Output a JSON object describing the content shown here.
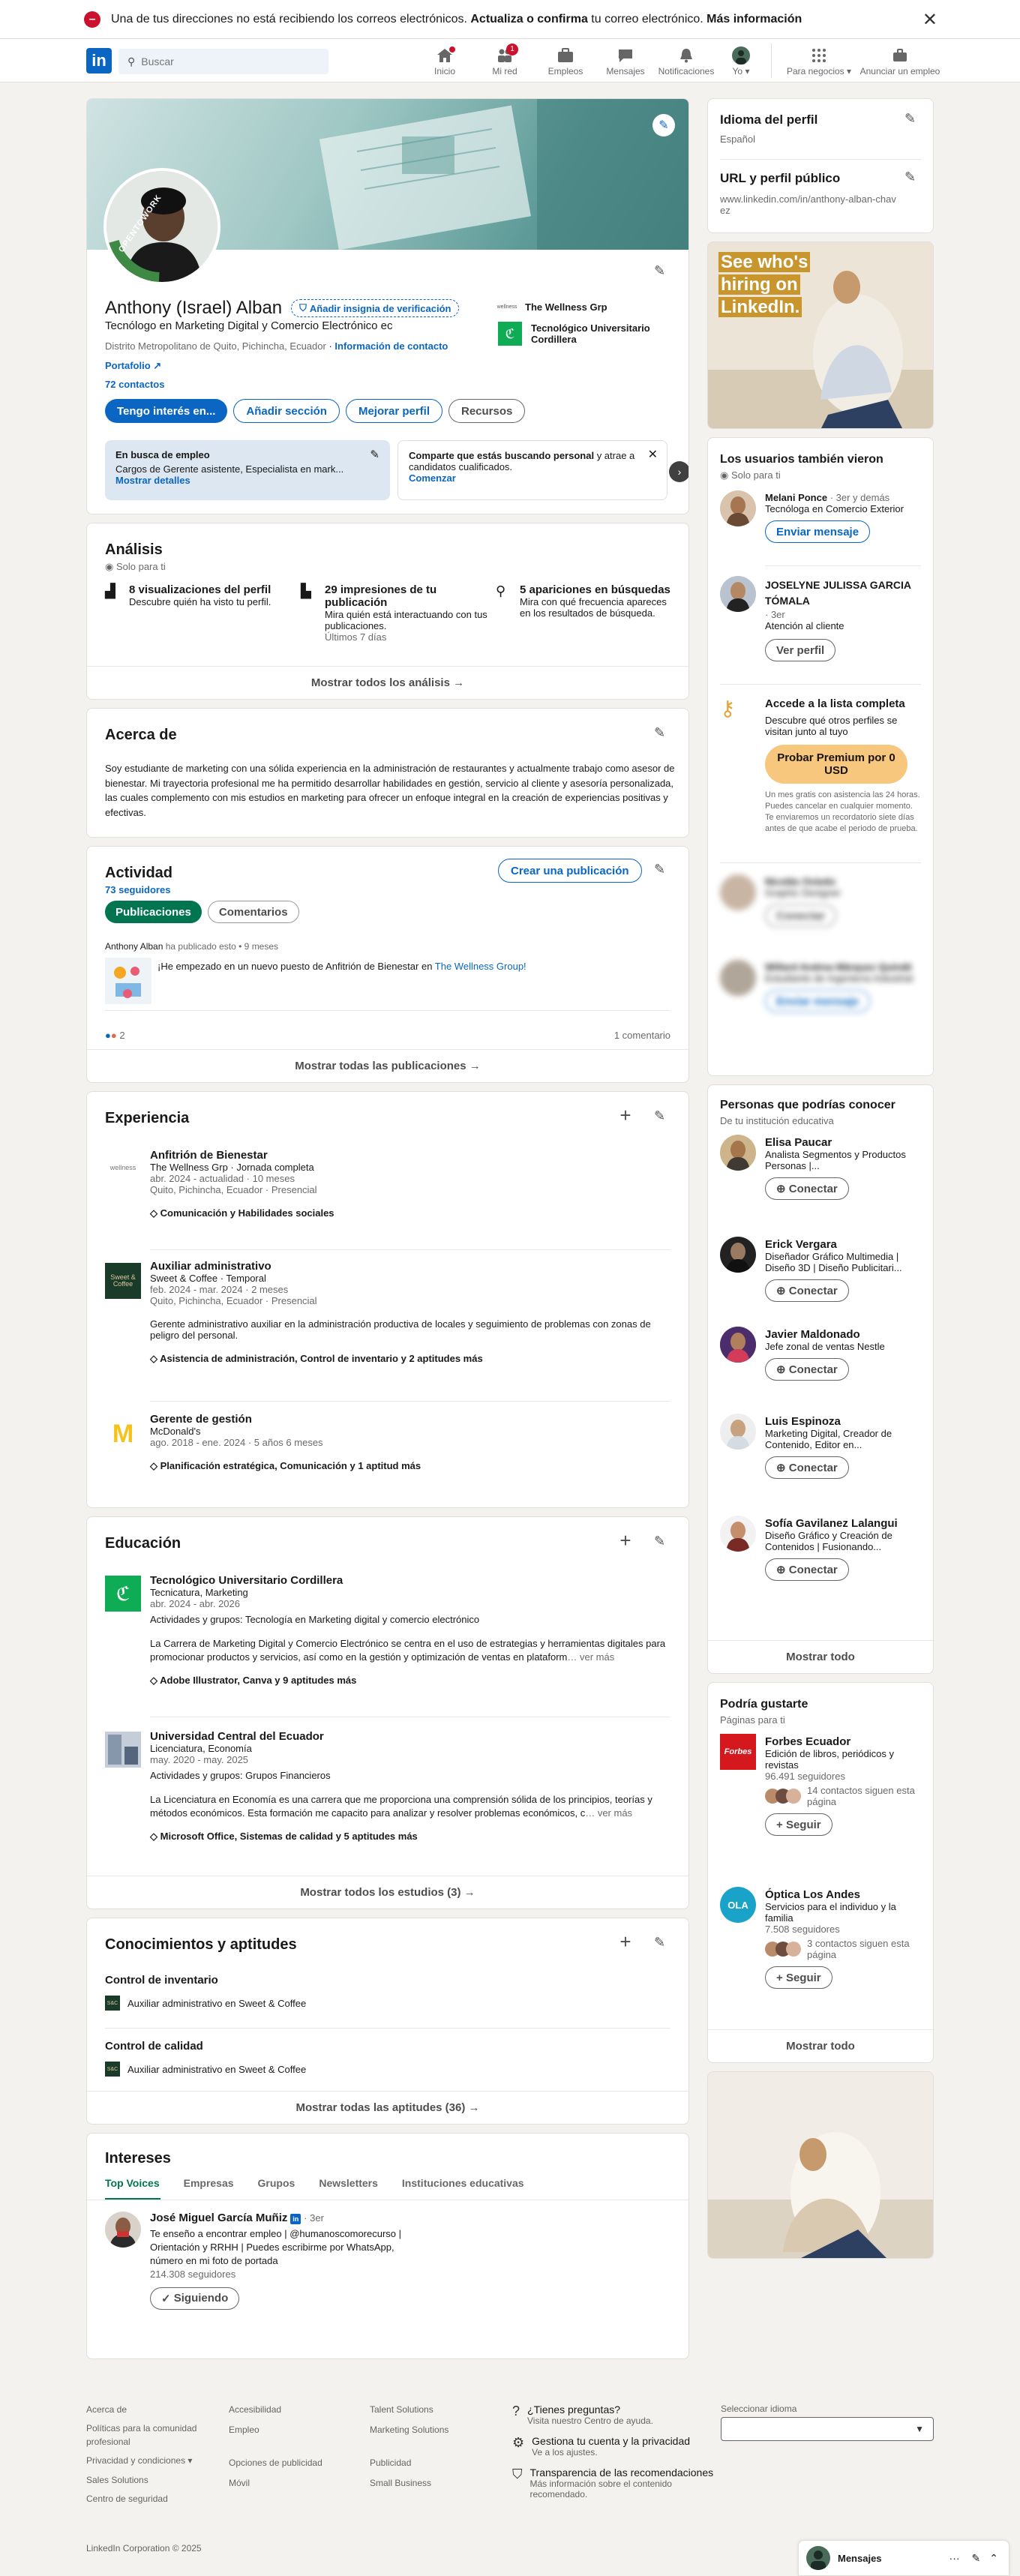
{
  "alert": {
    "text_before": "Una de tus direcciones no está recibiendo los correos electrónicos. ",
    "link1": "Actualiza o confirma",
    "text_mid": " tu correo electrónico. ",
    "link2": "Más información"
  },
  "nav": {
    "search_placeholder": "Buscar",
    "items": [
      {
        "label": "Inicio",
        "badge": ""
      },
      {
        "label": "Mi red",
        "badge": "1"
      },
      {
        "label": "Empleos",
        "badge": ""
      },
      {
        "label": "Mensajes",
        "badge": ""
      },
      {
        "label": "Notificaciones",
        "badge": ""
      },
      {
        "label": "Yo",
        "badge": ""
      }
    ],
    "business": "Para negocios",
    "advertise": "Anunciar un empleo"
  },
  "profile": {
    "cover_badge": "OPENTOWORK",
    "name": "Anthony (Israel) Alban",
    "verify": "Añadir insignia de verificación",
    "headline": "Tecnólogo en Marketing Digital y Comercio Electrónico ec",
    "location": "Distrito Metropolitano de Quito, Pichincha, Ecuador",
    "contact_info": "Información de contacto",
    "portfolio": "Portafolio",
    "connections": "72 contactos",
    "company1": "The Wellness Grp",
    "company2": "Tecnológico Universitario Cordillera",
    "buttons": {
      "interested": "Tengo interés en...",
      "add_section": "Añadir sección",
      "improve": "Mejorar perfil",
      "resources": "Recursos"
    },
    "otw": {
      "title": "En busca de empleo",
      "text": "Cargos de Gerente asistente, Especialista en mark...",
      "show": "Mostrar detalles"
    },
    "share": {
      "text_bold": "Comparte que estás buscando personal",
      "text_rest": " y atrae a candidatos cualificados.",
      "start": "Comenzar"
    }
  },
  "analytics": {
    "title": "Análisis",
    "private": "Solo para ti",
    "items": [
      {
        "title": "8 visualizaciones del perfil",
        "desc": "Descubre quién ha visto tu perfil.",
        "sub": ""
      },
      {
        "title": "29 impresiones de tu publicación",
        "desc": "Mira quién está interactuando con tus publicaciones.",
        "sub": "Últimos 7 días"
      },
      {
        "title": "5 apariciones en búsquedas",
        "desc": "Mira con qué frecuencia apareces en los resultados de búsqueda.",
        "sub": ""
      }
    ],
    "show_all": "Mostrar todos los análisis →"
  },
  "about": {
    "title": "Acerca de",
    "text": "Soy estudiante de marketing con una sólida experiencia en la administración de restaurantes y actualmente trabajo como asesor de bienestar. Mi trayectoria profesional me ha permitido desarrollar habilidades en gestión, servicio al cliente y asesoría personalizada, las cuales complemento con mis estudios en marketing para ofrecer un enfoque integral en la creación de experiencias positivas y efectivas."
  },
  "activity": {
    "title": "Actividad",
    "followers": "73 seguidores",
    "create": "Crear una publicación",
    "tab_posts": "Publicaciones",
    "tab_comments": "Comentarios",
    "post_meta_name": "Anthony Alban",
    "post_meta_rest": " ha publicado esto • 9 meses",
    "post_text": "¡He empezado en un nuevo puesto de Anfitrión de Bienestar en ",
    "post_link": "The Wellness Group!",
    "reactions": "2",
    "comments": "1 comentario",
    "show_all": "Mostrar todas las publicaciones →"
  },
  "experience": {
    "title": "Experiencia",
    "items": [
      {
        "role": "Anfitrión de Bienestar",
        "company": "The Wellness Grp · Jornada completa",
        "dates": "abr. 2024 - actualidad · 10 meses",
        "location": "Quito, Pichincha, Ecuador · Presencial",
        "desc": "",
        "skills": "Comunicación y Habilidades sociales"
      },
      {
        "role": "Auxiliar administrativo",
        "company": "Sweet & Coffee · Temporal",
        "dates": "feb. 2024 - mar. 2024 · 2 meses",
        "location": "Quito, Pichincha, Ecuador · Presencial",
        "desc": "Gerente administrativo auxiliar en la administración productiva de locales y seguimiento de problemas con zonas de peligro del personal.",
        "skills": "Asistencia de administración, Control de inventario y 2 aptitudes más"
      },
      {
        "role": "Gerente de gestión",
        "company": "McDonald's",
        "dates": "ago. 2018 - ene. 2024 · 5 años 6 meses",
        "location": "",
        "desc": "",
        "skills": "Planificación estratégica, Comunicación y 1 aptitud más"
      }
    ]
  },
  "education": {
    "title": "Educación",
    "items": [
      {
        "school": "Tecnológico Universitario Cordillera",
        "degree": "Tecnicatura, Marketing",
        "dates": "abr. 2024 - abr. 2026",
        "groups": "Actividades y grupos: Tecnología en Marketing digital y comercio electrónico",
        "desc": "La Carrera de Marketing Digital y Comercio Electrónico se centra en el uso de estrategias y herramientas digitales para promocionar productos y servicios, así como en la gestión y optimización de ventas en plataform",
        "more": "… ver más",
        "skills": "Adobe Illustrator, Canva y 9 aptitudes más"
      },
      {
        "school": "Universidad Central del Ecuador",
        "degree": "Licenciatura, Economía",
        "dates": "may. 2020 - may. 2025",
        "groups": "Actividades y grupos: Grupos Financieros",
        "desc": "La Licenciatura en Economía es una carrera que me proporciona una comprensión sólida de los principios, teorías y métodos económicos. Esta formación me capacito para analizar y resolver problemas económicos, c",
        "more": "… ver más",
        "skills": "Microsoft Office, Sistemas de calidad y 5 aptitudes más"
      }
    ],
    "show_all": "Mostrar todos los estudios (3) →"
  },
  "skills": {
    "title": "Conocimientos y aptitudes",
    "items": [
      {
        "name": "Control de inventario",
        "where": "Auxiliar administrativo en Sweet & Coffee"
      },
      {
        "name": "Control de calidad",
        "where": "Auxiliar administrativo en Sweet & Coffee"
      }
    ],
    "show_all": "Mostrar todas las aptitudes (36) →"
  },
  "interests": {
    "title": "Intereses",
    "tabs": [
      "Top Voices",
      "Empresas",
      "Grupos",
      "Newsletters",
      "Instituciones educativas"
    ],
    "person": {
      "name": "José Miguel García Muñiz",
      "degree": "· 3er",
      "desc": "Te enseño a encontrar empleo | @humanoscomorecurso | Orientación y RRHH | Puedes escribirme por WhatsApp, número en mi foto de portada",
      "followers": "214.308 seguidores",
      "button": "Siguiendo"
    }
  },
  "sidebar": {
    "lang_title": "Idioma del perfil",
    "lang_value": "Español",
    "url_title": "URL y perfil público",
    "url_value": "www.linkedin.com/in/anthony-alban-chavez",
    "ad_text": "See who's hiring on LinkedIn.",
    "viewers_title": "Los usuarios también vieron",
    "viewers_private": "Solo para ti",
    "viewers": [
      {
        "name": "Melani Ponce",
        "meta": "· 3er y demás",
        "title": "Tecnóloga en Comercio Exterior",
        "button": "Enviar mensaje"
      },
      {
        "name": "JOSELYNE JULISSA GARCIA TÓMALA",
        "meta": "· 3er",
        "title": "Atención al cliente",
        "button": "Ver perfil"
      }
    ],
    "premium_title": "Accede a la lista completa",
    "premium_text": "Descubre qué otros perfiles se visitan junto al tuyo",
    "premium_button": "Probar Premium por 0 USD",
    "premium_fine": "Un mes gratis con asistencia las 24 horas. Puedes cancelar en cualquier momento. Te enviaremos un recordatorio siete días antes de que acabe el periodo de prueba.",
    "blurred": [
      {
        "name": "Nicolás Oviedo",
        "title": "Graphic Designer",
        "button": "Conectar"
      },
      {
        "name": "Willard Andrea Márquez Quindé",
        "title": "Estudiante de Ingeniería Industrial",
        "button": "Enviar mensaje"
      }
    ],
    "pymk_title": "Personas que podrías conocer",
    "pymk_sub": "De tu institución educativa",
    "pymk": [
      {
        "name": "Elisa Paucar",
        "title": "Analista Segmentos y Productos Personas |...",
        "button": "Conectar"
      },
      {
        "name": "Erick Vergara",
        "title": "Diseñador Gráfico Multimedia | Diseño 3D | Diseño Publicitari...",
        "button": "Conectar"
      },
      {
        "name": "Javier Maldonado",
        "title": "Jefe zonal de ventas Nestle",
        "button": "Conectar"
      },
      {
        "name": "Luis Espinoza",
        "title": "Marketing Digital, Creador de Contenido, Editor en...",
        "button": "Conectar"
      },
      {
        "name": "Sofía Gavilanez Lalangui",
        "title": "Diseño Gráfico y Creación de Contenidos | Fusionando...",
        "button": "Conectar"
      }
    ],
    "pymk_show": "Mostrar todo",
    "pages_title": "Podría gustarte",
    "pages_sub": "Páginas para ti",
    "pages": [
      {
        "name": "Forbes Ecuador",
        "desc": "Edición de libros, periódicos y revistas",
        "followers": "96.491 seguidores",
        "contacts": "14 contactos siguen esta página",
        "button": "Seguir",
        "logo": "Forbes"
      },
      {
        "name": "Óptica Los Andes",
        "desc": "Servicios para el individuo y la familia",
        "followers": "7.508 seguidores",
        "contacts": "3 contactos siguen esta página",
        "button": "Seguir",
        "logo": "OLA"
      }
    ],
    "pages_show": "Mostrar todo"
  },
  "footer": {
    "col1": [
      "Acerca de",
      "Políticas para la comunidad profesional",
      "Privacidad y condiciones ▾",
      "Sales Solutions",
      "Centro de seguridad"
    ],
    "col2": [
      "Accesibilidad",
      "Empleo",
      "Opciones de publicidad",
      "Móvil"
    ],
    "col3": [
      "Talent Solutions",
      "Marketing Solutions",
      "Publicidad",
      "Small Business"
    ],
    "help": [
      {
        "title": "¿Tienes preguntas?",
        "sub": "Visita nuestro Centro de ayuda."
      },
      {
        "title": "Gestiona tu cuenta y la privacidad",
        "sub": "Ve a los ajustes."
      },
      {
        "title": "Transparencia de las recomendaciones",
        "sub": "Más información sobre el contenido recomendado."
      }
    ],
    "lang_label": "Seleccionar idioma",
    "copyright": "LinkedIn Corporation © 2025"
  },
  "messaging": {
    "label": "Mensajes"
  },
  "colors": {
    "brand": "#0a66c2",
    "green": "#01754f",
    "premium": "#f8c77e"
  }
}
